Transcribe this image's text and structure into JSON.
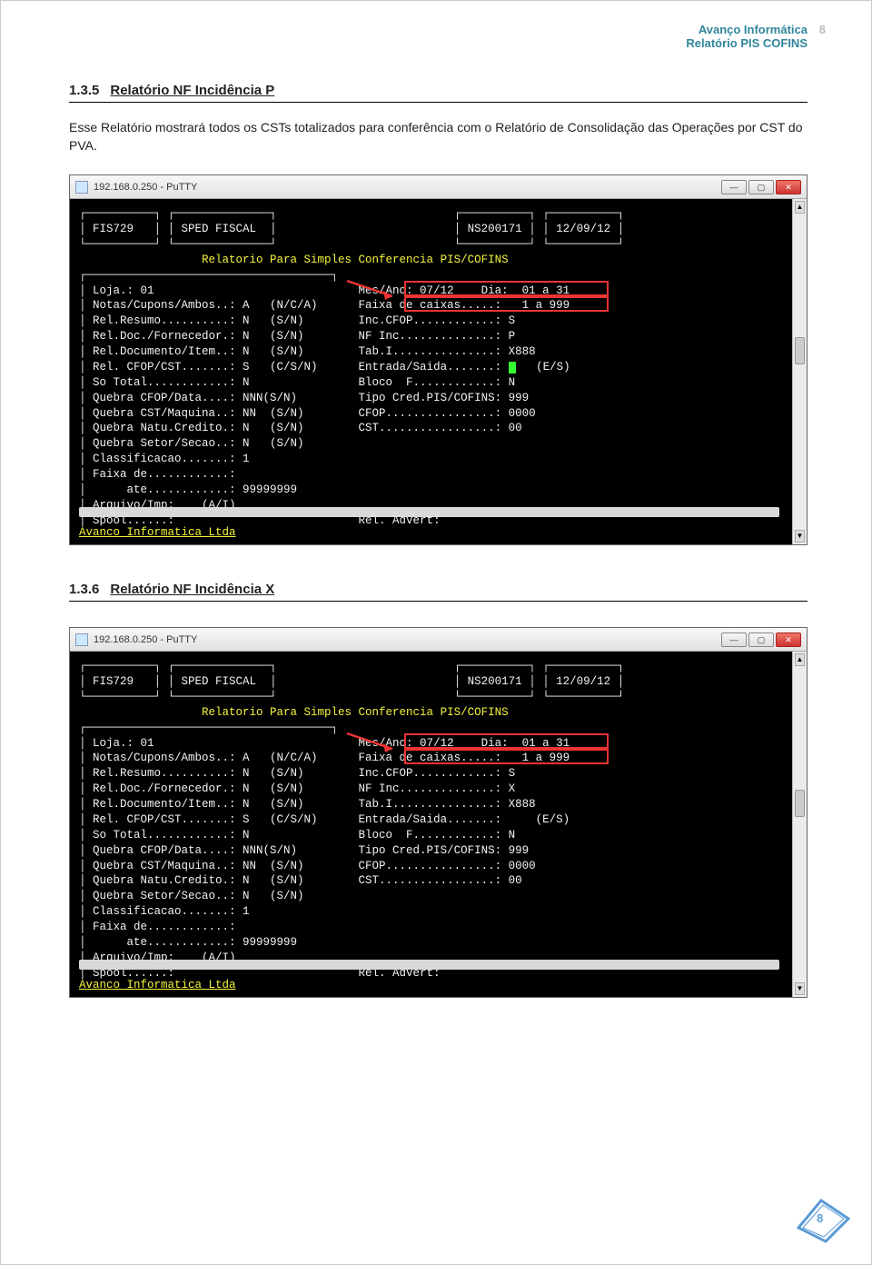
{
  "header": {
    "line1": "Avanço Informática",
    "line2": "Relatório PIS COFINS",
    "page": "8"
  },
  "sec1": {
    "num": "1.3.5",
    "title": "Relatório NF Incidência P",
    "para": "Esse Relatório mostrará todos os CSTs totalizados para conferência com o Relatório de Consolidação das Operações por CST do PVA."
  },
  "sec2": {
    "num": "1.3.6",
    "title": "Relatório NF Incidência X"
  },
  "putty": {
    "title": "192.168.0.250 - PuTTY"
  },
  "term_common": {
    "hdr_left1": "FIS729",
    "hdr_left2": "SPED FISCAL",
    "hdr_right1": "NS200171",
    "hdr_right2": "12/09/12",
    "subtitle": "Relatorio Para Simples Conferencia PIS/COFINS",
    "footer": "Avanco Informatica Ltda",
    "left_rows": [
      "Loja.: 01",
      "Notas/Cupons/Ambos..: A   (N/C/A)",
      "Rel.Resumo..........: N   (S/N)",
      "Rel.Doc./Fornecedor.: N   (S/N)",
      "Rel.Documento/Item..: N   (S/N)",
      "Rel. CFOP/CST.......: S   (C/S/N)",
      "So Total............: N",
      "Quebra CFOP/Data....: NNN(S/N)",
      "Quebra CST/Maquina..: NN  (S/N)",
      "Quebra Natu.Credito.: N   (S/N)",
      "Quebra Setor/Secao..: N   (S/N)",
      "Classificacao.......: 1",
      "Faixa de............:",
      "     ate............: 99999999",
      "Arquivo/Imp:    (A/I)",
      "Spool......:"
    ],
    "right_rows_common": [
      "Mes/Ano: 07/12    Dia:  01 a 31",
      "Faixa de caixas.....:   1 a 999"
    ],
    "right_rows_tail": [
      "Tab.I...............: X888",
      "Bloco  F............: N",
      "Tipo Cred.PIS/COFINS: 999",
      "CFOP................: 0000",
      "CST.................: 00"
    ],
    "rel_advert": "Rel. Advert:"
  },
  "term1": {
    "inc_cfop": "Inc.CFOP............: S",
    "nf_inc": "NF Inc..............: P",
    "entsai": "Entrada/Saida.......:     (E/S)",
    "cursor_after": true
  },
  "term2": {
    "inc_cfop": "Inc.CFOP............: S",
    "nf_inc": "NF Inc..............: X",
    "entsai": "Entrada/Saida.......:     (E/S)"
  },
  "footer_page": "8"
}
